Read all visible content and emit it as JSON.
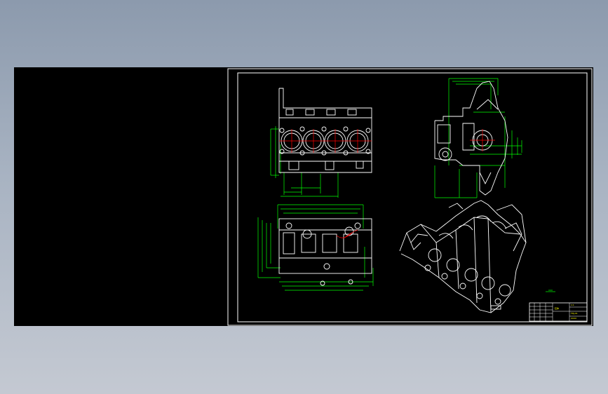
{
  "drawing": {
    "title_block": {
      "part_name": "缸体",
      "drawing_no": "FDJ-01",
      "company": "XXXX",
      "scale": "1:1"
    },
    "colors": {
      "background": "#000000",
      "outline": "#ffffff",
      "dimension": "#00ff00",
      "centerline": "#ff0000",
      "accent": "#ffff00"
    }
  }
}
